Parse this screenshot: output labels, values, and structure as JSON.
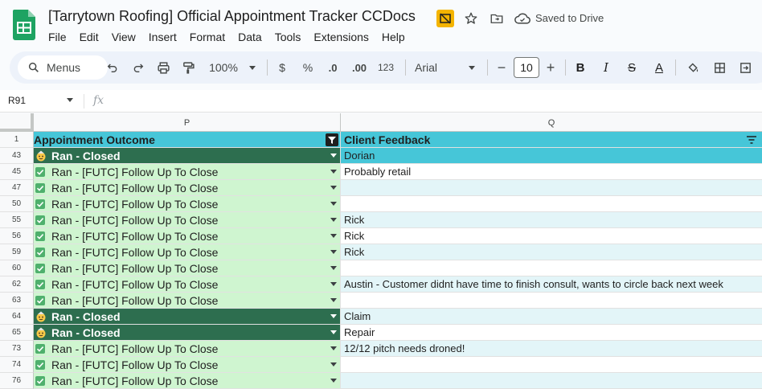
{
  "title": "[Tarrytown Roofing] Official Appointment Tracker CCDocs",
  "saved_status": "Saved to Drive",
  "menu": [
    "File",
    "Edit",
    "View",
    "Insert",
    "Format",
    "Data",
    "Tools",
    "Extensions",
    "Help"
  ],
  "toolbar": {
    "search_label": "Menus",
    "zoom": "100%",
    "currency": "$",
    "percent": "%",
    "dec_less": ".0",
    "dec_more": ".00",
    "num_format": "123",
    "font": "Arial",
    "font_size": "10",
    "bold": "B",
    "italic": "I",
    "strike": "S",
    "text_color": "A"
  },
  "formula": {
    "name_box": "R91",
    "fx": "fx"
  },
  "columns": {
    "p": "P",
    "q": "Q"
  },
  "header_row": {
    "num": "1",
    "p": "Appointment Outcome",
    "q": "Client Feedback"
  },
  "rows": [
    {
      "num": "43",
      "outcome": "Ran - Closed",
      "feedback": "Dorian"
    },
    {
      "num": "45",
      "outcome": "Ran - [FUTC] Follow Up To Close",
      "feedback": "Probably retail"
    },
    {
      "num": "47",
      "outcome": "Ran - [FUTC] Follow Up To Close",
      "feedback": ""
    },
    {
      "num": "50",
      "outcome": "Ran - [FUTC] Follow Up To Close",
      "feedback": ""
    },
    {
      "num": "55",
      "outcome": "Ran - [FUTC] Follow Up To Close",
      "feedback": "Rick"
    },
    {
      "num": "56",
      "outcome": "Ran - [FUTC] Follow Up To Close",
      "feedback": "Rick"
    },
    {
      "num": "59",
      "outcome": "Ran - [FUTC] Follow Up To Close",
      "feedback": "Rick"
    },
    {
      "num": "60",
      "outcome": "Ran - [FUTC] Follow Up To Close",
      "feedback": ""
    },
    {
      "num": "62",
      "outcome": "Ran - [FUTC] Follow Up To Close",
      "feedback": "Austin - Customer didnt have time to finish consult, wants to circle back next week"
    },
    {
      "num": "63",
      "outcome": "Ran - [FUTC] Follow Up To Close",
      "feedback": ""
    },
    {
      "num": "64",
      "outcome": "Ran - Closed",
      "feedback": "Claim"
    },
    {
      "num": "65",
      "outcome": "Ran - Closed",
      "feedback": "Repair"
    },
    {
      "num": "73",
      "outcome": "Ran - [FUTC] Follow Up To Close",
      "feedback": "12/12 pitch needs droned!"
    },
    {
      "num": "74",
      "outcome": "Ran - [FUTC] Follow Up To Close",
      "feedback": ""
    },
    {
      "num": "76",
      "outcome": "Ran - [FUTC] Follow Up To Close",
      "feedback": ""
    }
  ],
  "colors": {
    "header_teal": "#46c6d8",
    "futc_green": "#cff5d0",
    "closed_dark_green": "#2d6e4f",
    "band_light": "#e3f5f8"
  },
  "icons": {
    "closed_chip": "party-face-icon",
    "futc_chip": "check-mark-icon"
  }
}
